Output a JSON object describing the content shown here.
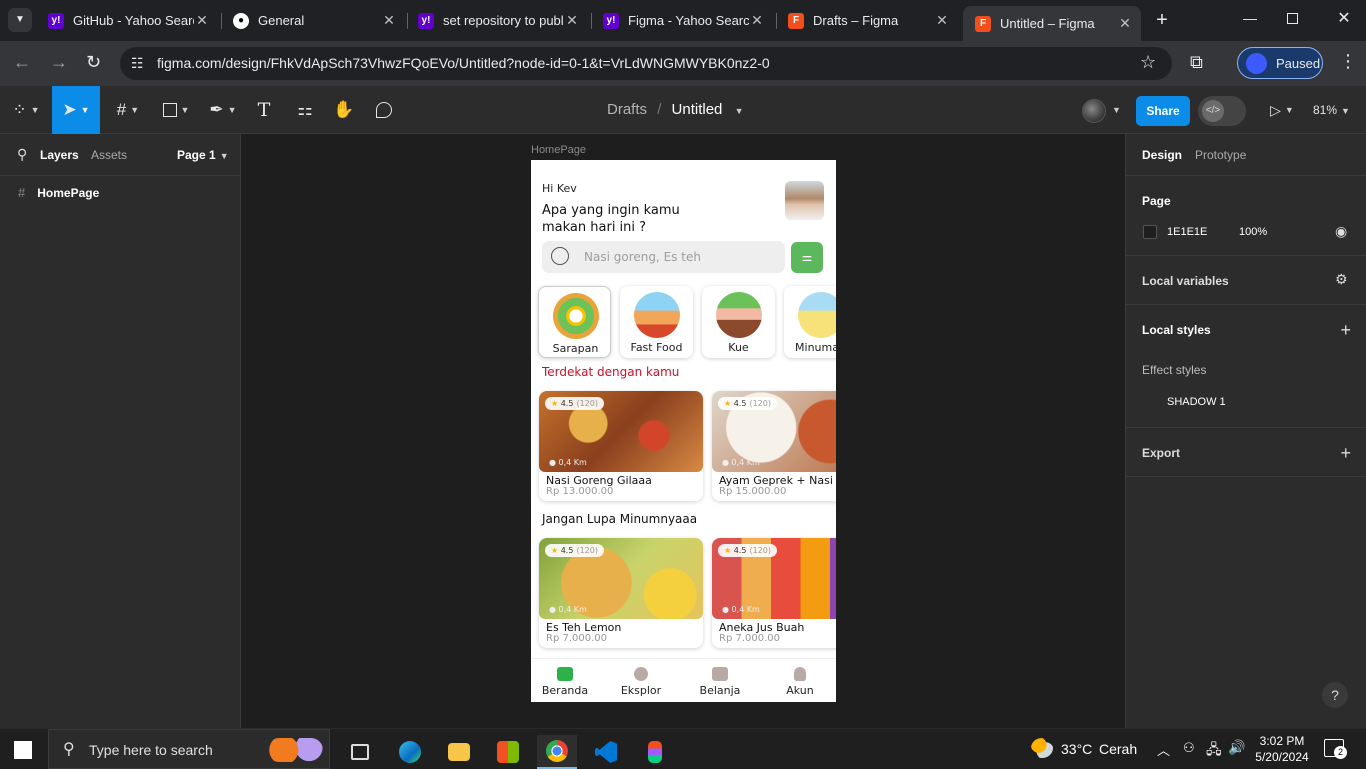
{
  "browser": {
    "tabs": [
      {
        "title": "GitHub - Yahoo Search",
        "favicon": "yahoo-icon",
        "color": "#6001d2"
      },
      {
        "title": "General",
        "favicon": "github-icon",
        "color": "#ffffff"
      },
      {
        "title": "set repository to public",
        "favicon": "yahoo-icon",
        "color": "#6001d2"
      },
      {
        "title": "Figma - Yahoo Search",
        "favicon": "yahoo-icon",
        "color": "#6001d2"
      },
      {
        "title": "Drafts – Figma",
        "favicon": "figma-icon",
        "color": "#f24e1e"
      },
      {
        "title": "Untitled – Figma",
        "favicon": "figma-icon",
        "color": "#f24e1e"
      }
    ],
    "new_tab": "+",
    "url": "figma.com/design/FhkVdApSch73VhwzFQoEVo/Untitled?node-id=0-1&t=VrLdWNGMWYBK0nz2-0",
    "profile_label": "Paused"
  },
  "figma": {
    "breadcrumb": {
      "folder": "Drafts",
      "separator": "/",
      "file": "Untitled"
    },
    "share_label": "Share",
    "zoom": "81%",
    "left_panel": {
      "tabs": [
        "Layers",
        "Assets"
      ],
      "page": "Page 1",
      "layers": [
        "HomePage"
      ]
    },
    "right_panel": {
      "tabs": [
        "Design",
        "Prototype"
      ],
      "page_title": "Page",
      "page_color": "1E1E1E",
      "page_opacity": "100%",
      "local_variables": "Local variables",
      "local_styles": "Local styles",
      "effect_styles": "Effect styles",
      "effect_style_item": "SHADOW 1",
      "export": "Export"
    },
    "help": "?"
  },
  "frame": {
    "label": "HomePage",
    "greeting": "Hi Kev",
    "question_line1": "Apa yang ingin kamu",
    "question_line2": "makan hari ini ?",
    "search_placeholder": "Nasi goreng, Es teh",
    "categories": [
      "Sarapan",
      "Fast Food",
      "Kue",
      "Minuman"
    ],
    "section1_title": "Terdekat dengan kamu",
    "section2_title": "Jangan Lupa Minumnyaaa",
    "rating": "4.5",
    "rating_count": "(120)",
    "distance": "0,4 Km",
    "foods": [
      {
        "name": "Nasi Goreng Gilaaa",
        "price": "Rp 13.000.00"
      },
      {
        "name": "Ayam Geprek + Nasi",
        "price": "Rp 15.000.00"
      }
    ],
    "drinks": [
      {
        "name": "Es Teh Lemon",
        "price": "Rp 7.000.00"
      },
      {
        "name": "Aneka Jus Buah",
        "price": "Rp 7.000.00"
      }
    ],
    "bottom_nav": [
      "Beranda",
      "Eksplor",
      "Belanja",
      "Akun"
    ],
    "accent_red": "#c8102e",
    "accent_green": "#2db24a"
  },
  "taskbar": {
    "search_placeholder": "Type here to search",
    "weather_temp": "33°C",
    "weather_text": "Cerah",
    "time": "3:02 PM",
    "date": "5/20/2024",
    "notifications": "2"
  }
}
